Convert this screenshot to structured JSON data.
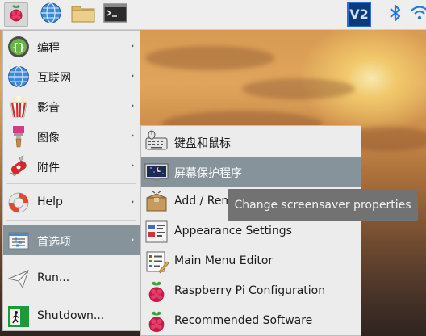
{
  "panel": {
    "menu_icon": "raspberry-icon",
    "browser_icon": "globe-icon",
    "files_icon": "folder-icon",
    "terminal_icon": "terminal-icon",
    "vnc_label": "V2",
    "bluetooth_icon": "bluetooth-icon",
    "network_icon": "wifi-icon"
  },
  "main_menu": {
    "items": [
      {
        "label": "编程",
        "icon": "programming-icon",
        "has_submenu": true
      },
      {
        "label": "互联网",
        "icon": "globe-icon",
        "has_submenu": true
      },
      {
        "label": "影音",
        "icon": "popcorn-icon",
        "has_submenu": true
      },
      {
        "label": "图像",
        "icon": "paintbrush-icon",
        "has_submenu": true
      },
      {
        "label": "附件",
        "icon": "swiss-knife-icon",
        "has_submenu": true
      },
      {
        "label": "Help",
        "icon": "lifebuoy-icon",
        "has_submenu": true
      },
      {
        "label": "首选项",
        "icon": "preferences-icon",
        "has_submenu": true,
        "selected": true
      },
      {
        "label": "Run...",
        "icon": "paper-plane-icon",
        "has_submenu": false
      },
      {
        "label": "Shutdown...",
        "icon": "exit-icon",
        "has_submenu": false
      }
    ],
    "arrow": "›"
  },
  "sub_menu": {
    "items": [
      {
        "label": "键盘和鼠标",
        "icon": "keyboard-mouse-icon"
      },
      {
        "label": "屏幕保护程序",
        "icon": "screensaver-icon",
        "selected": true
      },
      {
        "label": "Add / Remove Software",
        "icon": "package-icon"
      },
      {
        "label": "Appearance Settings",
        "icon": "appearance-icon"
      },
      {
        "label": "Main Menu Editor",
        "icon": "menu-editor-icon"
      },
      {
        "label": "Raspberry Pi Configuration",
        "icon": "raspberry-icon"
      },
      {
        "label": "Recommended Software",
        "icon": "raspberry-icon"
      }
    ]
  },
  "tooltip": {
    "text": "Change screensaver properties"
  },
  "colors": {
    "selection": "#87939a",
    "menu_bg": "#ececec",
    "tooltip_bg": "#727272",
    "vnc_blue": "#2a6fd6",
    "bluetooth_blue": "#1f7de0"
  }
}
